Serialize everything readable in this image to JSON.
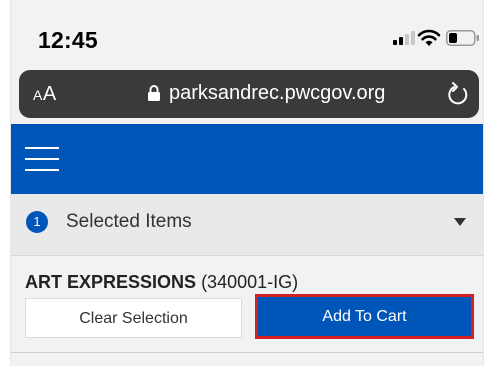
{
  "status_bar": {
    "time": "12:45",
    "signal_icon": "signal-icon",
    "wifi_icon": "wifi-icon",
    "battery_icon": "battery-icon"
  },
  "browser": {
    "text_size_label_small": "A",
    "text_size_label_large": "A",
    "url": "parksandrec.pwcgov.org",
    "lock_icon": "lock-icon",
    "reload_icon": "reload-icon"
  },
  "header": {
    "menu_icon": "hamburger-menu-icon",
    "brand_color": "#0055b8"
  },
  "selected_items": {
    "count": "1",
    "label": "Selected Items",
    "toggle_icon": "caret-down-icon"
  },
  "program": {
    "name": "ART EXPRESSIONS",
    "code": "(340001-IG)",
    "clear_label": "Clear Selection",
    "add_label": "Add To Cart",
    "highlight_color": "#d42020"
  }
}
